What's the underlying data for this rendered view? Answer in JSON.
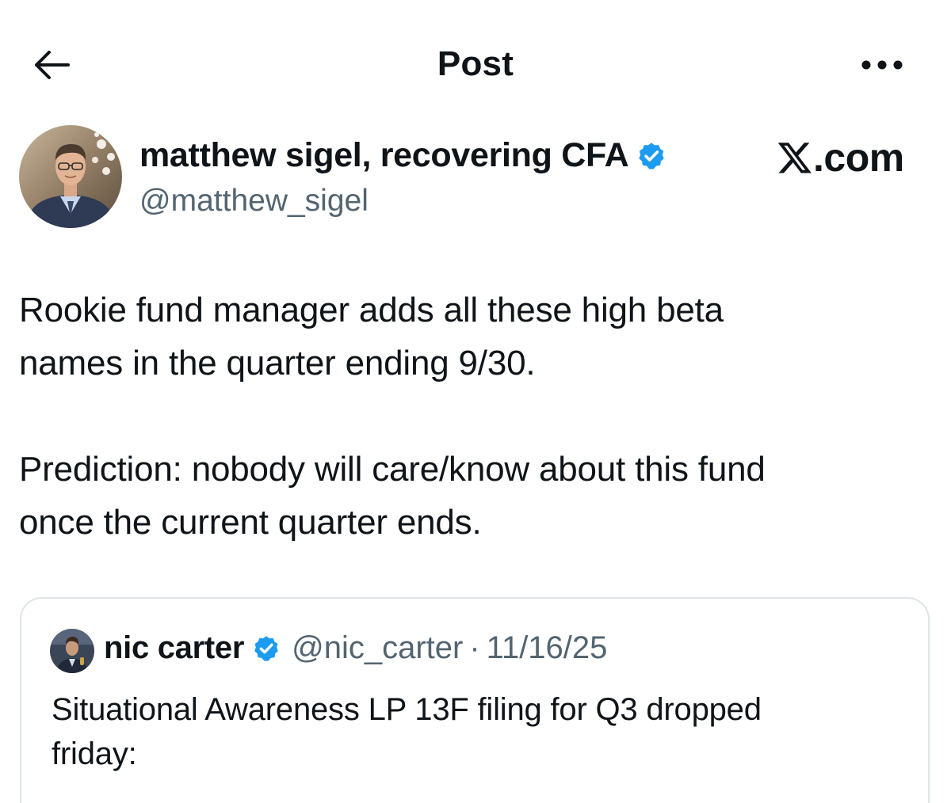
{
  "header": {
    "title": "Post",
    "back_icon": "arrow-left-icon",
    "more_icon": "more-horizontal-icon"
  },
  "author": {
    "name": "matthew sigel, recovering CFA",
    "handle": "@matthew_sigel",
    "verified_icon": "verified-badge-icon"
  },
  "brand": {
    "suffix": ".com"
  },
  "post": {
    "paragraph1_line1": "Rookie fund manager adds all these high beta",
    "paragraph1_line2": "names in the quarter ending 9/30.",
    "paragraph2_line1": "Prediction: nobody will care/know about this fund",
    "paragraph2_line2": "once the current quarter ends."
  },
  "quote": {
    "name": "nic carter",
    "handle": "@nic_carter",
    "separator": "·",
    "date": "11/16/25",
    "text_line1": "Situational Awareness LP 13F filing for Q3 dropped",
    "text_line2": "friday:"
  },
  "colors": {
    "text": "#0f1419",
    "secondary": "#536471",
    "verified": "#1d9bf0",
    "border": "#dfe3e6"
  }
}
